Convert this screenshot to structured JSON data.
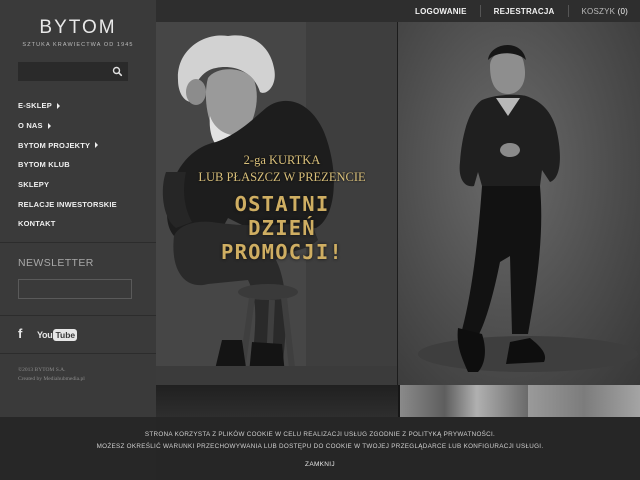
{
  "logo": {
    "name": "BYTOM",
    "tagline": "SZTUKA KRAWIECTWA OD 1945"
  },
  "search": {
    "placeholder": ""
  },
  "nav": [
    {
      "label": "E-SKLEP",
      "has_submenu": true
    },
    {
      "label": "O NAS",
      "has_submenu": true
    },
    {
      "label": "BYTOM PROJEKTY",
      "has_submenu": true
    },
    {
      "label": "BYTOM KLUB",
      "has_submenu": false
    },
    {
      "label": "SKLEPY",
      "has_submenu": false
    },
    {
      "label": "RELACJE INWESTORSKIE",
      "has_submenu": false
    },
    {
      "label": "KONTAKT",
      "has_submenu": false
    }
  ],
  "newsletter": {
    "title": "NEWSLETTER",
    "placeholder": ""
  },
  "social": {
    "facebook": "f",
    "youtube_you": "You",
    "youtube_tube": "Tube"
  },
  "footer": {
    "copyright": "©2013 BYTOM S.A.",
    "credit": "Created by Mediahubmedia.pl"
  },
  "topbar": {
    "login": "LOGOWANIE",
    "register": "REJESTRACJA",
    "cart_label": "KOSZYK",
    "cart_count": "(0)"
  },
  "promo": {
    "line1": "2-ga KURTKA",
    "line2": "LUB PŁASZCZ W PREZENCIE",
    "big1": "OSTATNI",
    "big2": "DZIEŃ",
    "big3": "PROMOCJI!"
  },
  "cookie": {
    "line1": "STRONA KORZYSTA Z PLIKÓW COOKIE W CELU REALIZACJI USŁUG ZGODNIE Z POLITYKĄ PRYWATNOŚCI.",
    "line2": "MOŻESZ OKREŚLIĆ WARUNKI PRZECHOWYWANIA LUB DOSTĘPU DO COOKIE W TWOJEJ PRZEGLĄDARCE LUB KONFIGURACJI USŁUGI.",
    "close": "ZAMKNIJ"
  },
  "colors": {
    "sidebar": "#3a3a3a",
    "topbar": "#2e2e2e",
    "promo_gold": "#cfae62"
  }
}
